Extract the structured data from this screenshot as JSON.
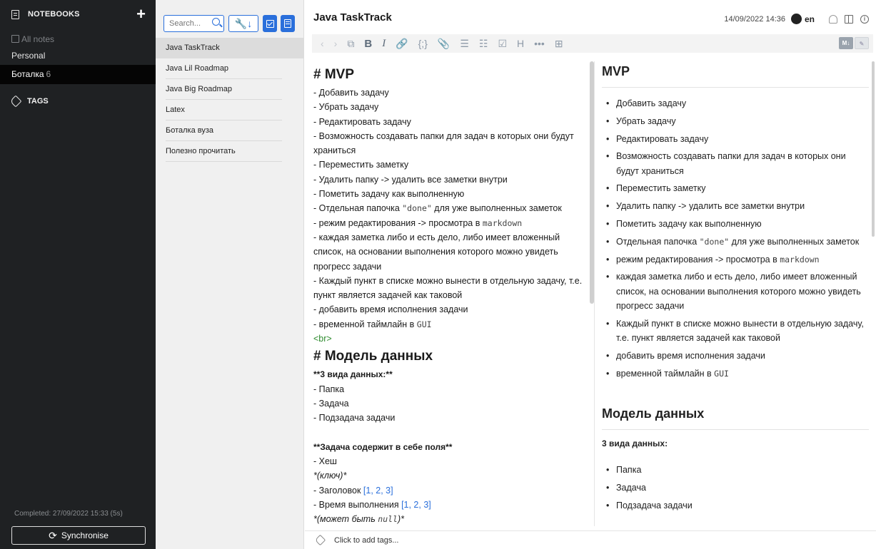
{
  "sidebar": {
    "title": "NOTEBOOKS",
    "add_icon": "plus-icon",
    "all_notes": "All notes",
    "notebooks": [
      {
        "label": "Personal",
        "count": ""
      },
      {
        "label": "Боталка",
        "count": "6"
      }
    ],
    "tags_title": "TAGS",
    "completed": "Completed: 27/09/2022 15:33 (5s)",
    "sync_label": "Synchronise"
  },
  "notes_list": {
    "search_placeholder": "Search...",
    "items": [
      "Java TaskTrack",
      "Java Lil Roadmap",
      "Java Big Roadmap",
      "Latex",
      "Боталка вуза",
      "Полезно прочитать"
    ]
  },
  "editor": {
    "title": "Java TaskTrack",
    "date": "14/09/2022 14:36",
    "lang": "en",
    "toolbar_md_label": "M↓",
    "source": {
      "h1": "# MVP",
      "mvp": [
        "- Добавить задачу",
        "- Убрать задачу",
        "- Редактировать задачу",
        "- Возможность создавать папки для задач в которых они будут храниться",
        "- Переместить заметку",
        "- Удалить папку -> удалить все заметки внутри",
        "- Пометить задачу как выполненную"
      ],
      "done_pre": "- Отдельная папочка ",
      "done_code": "\"done\"",
      "done_post": " для уже выполненных заметок",
      "md_pre": "- режим редактирования -> просмотра в ",
      "md_code": "markdown",
      "mvp2": [
        "- каждая заметка либо и есть дело, либо имеет вложенный список, на основании выполнения которого можно увидеть прогресс задачи",
        "- Каждый пункт в списке можно вынести в отдельную задачу, т.е. пункт является задачей как таковой",
        "- добавить время исполнения задачи"
      ],
      "gui_pre": "- временной таймлайн в ",
      "gui_code": "GUI",
      "br": "<br>",
      "h2": "# Модель данных",
      "b1": "**3 вида данных:**",
      "types": [
        "- Папка",
        "- Задача",
        "- Подзадача задачи"
      ],
      "b2": "**Задача содержит в себе поля**",
      "hash": "- Хеш",
      "key": "*(ключ)*",
      "title_pre": "- Заголовок ",
      "title_link": "[1, 2, 3]",
      "time_pre": "- Время выполнения ",
      "time_link": "[1, 2, 3]",
      "null_pre": "*(может быть ",
      "null_code": "null",
      "null_post": ")*"
    },
    "preview": {
      "h1": "MVP",
      "mvp": [
        "Добавить задачу",
        "Убрать задачу",
        "Редактировать задачу",
        "Возможность создавать папки для задач в которых они будут храниться",
        "Переместить заметку",
        "Удалить папку -> удалить все заметки внутри",
        "Пометить задачу как выполненную"
      ],
      "done_pre": "Отдельная папочка ",
      "done_code": "\"done\"",
      "done_post": " для уже выполненных заметок",
      "md_pre": "режим редактирования -> просмотра в ",
      "md_code": "markdown",
      "mvp2": [
        "каждая заметка либо и есть дело, либо имеет вложенный список, на основании выполнения которого можно увидеть прогресс задачи",
        "Каждый пункт в списке можно вынести в отдельную задачу, т.е. пункт является задачей как таковой",
        "добавить время исполнения задачи"
      ],
      "gui_pre": "временной таймлайн в ",
      "gui_code": "GUI",
      "h2": "Модель данных",
      "b1": "3 вида данных:",
      "types": [
        "Папка",
        "Задача",
        "Подзадача задачи"
      ]
    },
    "tags_placeholder": "Click to add tags..."
  }
}
